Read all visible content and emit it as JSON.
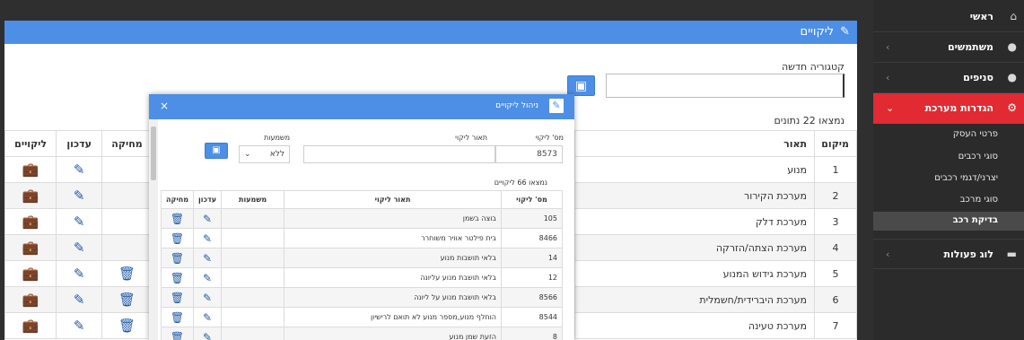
{
  "sidebar": {
    "items": [
      {
        "label": "ראשי",
        "icon": "home-icon",
        "glyph": "⌂"
      },
      {
        "label": "משתמשים",
        "icon": "user-icon",
        "glyph": "●",
        "chevron": "‹"
      },
      {
        "label": "סניפים",
        "icon": "users-icon",
        "glyph": "●",
        "chevron": "‹"
      },
      {
        "label": "הגדרות מערכת",
        "icon": "gears-icon",
        "glyph": "⚙",
        "chevron": "⌄"
      }
    ],
    "sub_items": [
      {
        "label": "פרטי העסק"
      },
      {
        "label": "סוגי רכבים"
      },
      {
        "label": "יצרני/דגמי רכבים"
      },
      {
        "label": "סוגי מרכב"
      },
      {
        "label": "בדיקת רכב"
      }
    ],
    "log": {
      "label": "לוג פעולות",
      "icon": "archive-icon",
      "glyph": "▬",
      "chevron": "‹"
    }
  },
  "main": {
    "title": "ליקויים",
    "title_glyph": "✎",
    "new_category_label": "קטגוריה חדשה",
    "new_category_value": "",
    "save_glyph": "▣",
    "found_text": "נמצאו 22 נתונים",
    "table": {
      "headers": {
        "location": "מיקום",
        "description": "תאור",
        "defects": "ליקויים",
        "update": "עדכון",
        "delete": "מחיקה"
      },
      "rows": [
        {
          "location": "1",
          "description": "מנוע"
        },
        {
          "location": "2",
          "description": "מערכת הקירור"
        },
        {
          "location": "3",
          "description": "מערכת דלק"
        },
        {
          "location": "4",
          "description": "מערכת הצתה/הזרקה"
        },
        {
          "location": "5",
          "description": "מערכת גידוש המנוע"
        },
        {
          "location": "6",
          "description": "מערכת היברידית/חשמלית"
        },
        {
          "location": "7",
          "description": "מערכת טעינה"
        }
      ]
    }
  },
  "modal": {
    "title": "ניהול ליקויים",
    "close_glyph": "×",
    "header_glyph": "✎",
    "fields": {
      "defect_number_label": "מס' ליקוי",
      "defect_number_value": "8573",
      "defect_desc_label": "תאור ליקוי",
      "defect_desc_value": "",
      "meaning_label": "משמעות",
      "meaning_value": "ללא"
    },
    "found_text": "נמצאו 66 ליקויים",
    "table": {
      "headers": {
        "number": "מס' ליקוי",
        "description": "תאור ליקוי",
        "meaning": "משמעות",
        "update": "עדכון",
        "delete": "מחיקה"
      },
      "rows": [
        {
          "number": "105",
          "description": "בוצה בשמן"
        },
        {
          "number": "8466",
          "description": "בית פילטר אוויר משוחרר"
        },
        {
          "number": "14",
          "description": "בלאי תושבות מנוע"
        },
        {
          "number": "12",
          "description": "בלאי תושבת מנוע עליונה"
        },
        {
          "number": "8566",
          "description": "בלאי תושבת מנוע על ליונה"
        },
        {
          "number": "8544",
          "description": "הוחלף מנוע,מספר מנוע לא תואם לרישיון"
        },
        {
          "number": "8",
          "description": "הזעת שמן מנוע"
        }
      ]
    }
  },
  "colors": {
    "primary": "#4d8fe6",
    "sidebar_bg": "#2b2b2b",
    "active": "#e12a32"
  }
}
